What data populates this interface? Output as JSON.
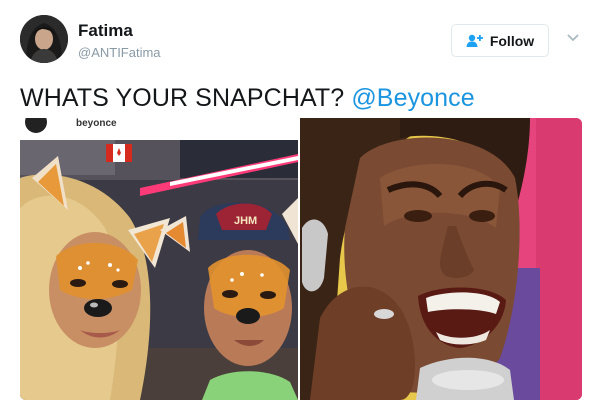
{
  "tweet": {
    "author_name": "Fatima",
    "author_handle": "@ANTIFatima",
    "follow_label": "Follow",
    "text": "WHATS YOUR SNAPCHAT? ",
    "mention": "@Beyonce"
  },
  "media": {
    "left_photo": {
      "cropped_username": "beyonce",
      "cap_text": "JHM"
    }
  },
  "colors": {
    "link": "#1b95e0",
    "name": "#14171a",
    "handle": "#8899a6",
    "button_border": "#e1e8ed"
  },
  "icons": {
    "follow": "add-user-icon",
    "menu": "chevron-down-icon"
  }
}
